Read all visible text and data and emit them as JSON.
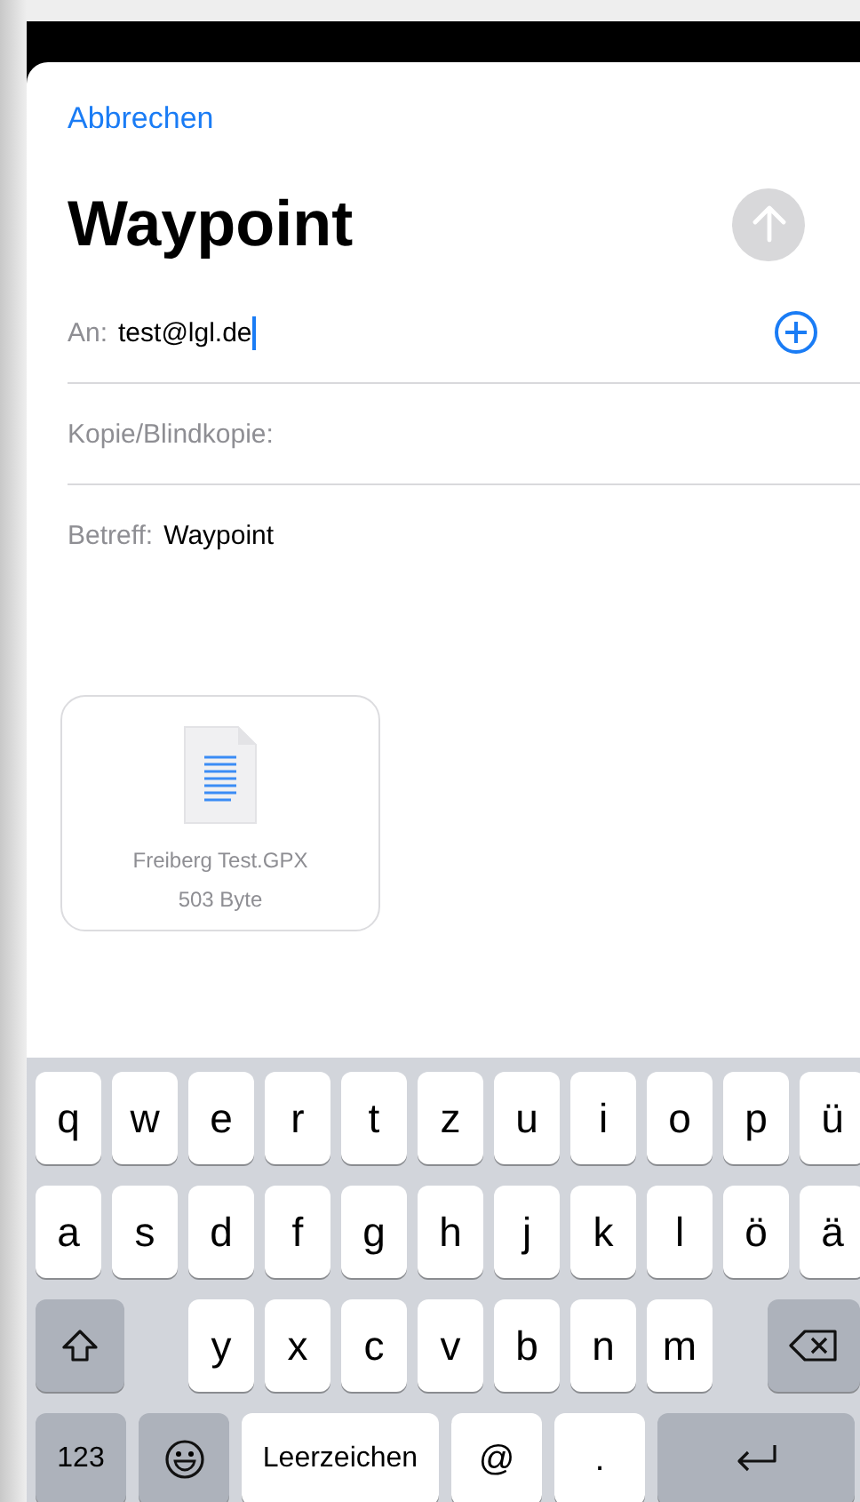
{
  "cancel": "Abbrechen",
  "title": "Waypoint",
  "send": {
    "disabled": true
  },
  "fields": [
    {
      "kind": "recipient",
      "label": "An:",
      "value": "test@lgl.de",
      "focused": true,
      "add_button": true
    },
    {
      "kind": "cc",
      "label": "Kopie/Blindkopie:"
    },
    {
      "kind": "subject",
      "label": "Betreff:",
      "value": "Waypoint"
    }
  ],
  "attachment": {
    "name": "Freiberg Test.GPX",
    "size": "503 Byte"
  },
  "keyboard": {
    "rows": [
      [
        {
          "kind": "letter",
          "label": "q"
        },
        {
          "kind": "letter",
          "label": "w"
        },
        {
          "kind": "letter",
          "label": "e"
        },
        {
          "kind": "letter",
          "label": "r"
        },
        {
          "kind": "letter",
          "label": "t"
        },
        {
          "kind": "letter",
          "label": "z"
        },
        {
          "kind": "letter",
          "label": "u"
        },
        {
          "kind": "letter",
          "label": "i"
        },
        {
          "kind": "letter",
          "label": "o"
        },
        {
          "kind": "letter",
          "label": "p"
        },
        {
          "kind": "letter",
          "label": "ü"
        }
      ],
      [
        {
          "kind": "letter",
          "label": "a"
        },
        {
          "kind": "letter",
          "label": "s"
        },
        {
          "kind": "letter",
          "label": "d"
        },
        {
          "kind": "letter",
          "label": "f"
        },
        {
          "kind": "letter",
          "label": "g"
        },
        {
          "kind": "letter",
          "label": "h"
        },
        {
          "kind": "letter",
          "label": "j"
        },
        {
          "kind": "letter",
          "label": "k"
        },
        {
          "kind": "letter",
          "label": "l"
        },
        {
          "kind": "letter",
          "label": "ö"
        },
        {
          "kind": "letter",
          "label": "ä"
        }
      ],
      [
        {
          "kind": "shift"
        },
        {
          "kind": "gap"
        },
        {
          "kind": "letter",
          "label": "y"
        },
        {
          "kind": "letter",
          "label": "x"
        },
        {
          "kind": "letter",
          "label": "c"
        },
        {
          "kind": "letter",
          "label": "v"
        },
        {
          "kind": "letter",
          "label": "b"
        },
        {
          "kind": "letter",
          "label": "n"
        },
        {
          "kind": "letter",
          "label": "m"
        },
        {
          "kind": "backspace"
        }
      ]
    ],
    "bottom_row": [
      {
        "kind": "mode",
        "label": "123"
      },
      {
        "kind": "emoji"
      },
      {
        "kind": "space",
        "label": "Leerzeichen"
      },
      {
        "kind": "symbol",
        "label": "@"
      },
      {
        "kind": "symbol",
        "label": "."
      },
      {
        "kind": "return"
      }
    ]
  }
}
